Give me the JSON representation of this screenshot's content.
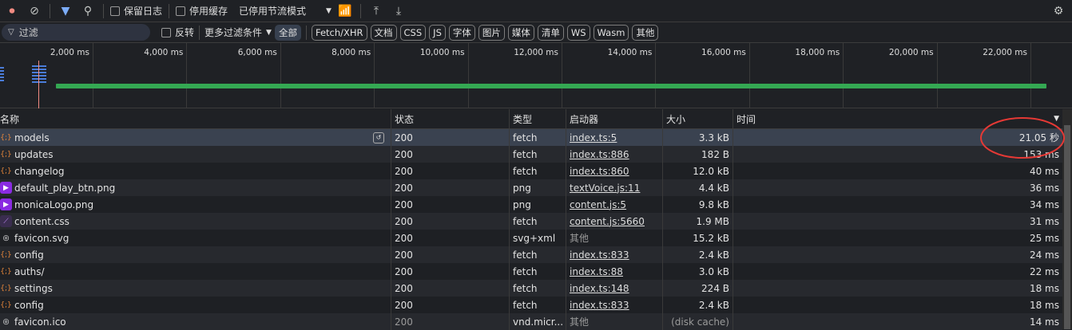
{
  "toolbar": {
    "preserve_log": "保留日志",
    "disable_cache": "停用缓存",
    "throttle": "已停用节流模式"
  },
  "filter": {
    "placeholder": "过滤",
    "invert": "反转",
    "more_filters": "更多过滤条件",
    "chips": [
      "全部",
      "Fetch/XHR",
      "文档",
      "CSS",
      "JS",
      "字体",
      "图片",
      "媒体",
      "清单",
      "WS",
      "Wasm",
      "其他"
    ]
  },
  "overview": {
    "ticks": [
      "2,000 ms",
      "4,000 ms",
      "6,000 ms",
      "8,000 ms",
      "10,000 ms",
      "12,000 ms",
      "14,000 ms",
      "16,000 ms",
      "18,000 ms",
      "20,000 ms",
      "22,000 ms"
    ]
  },
  "table": {
    "headers": [
      "名称",
      "状态",
      "类型",
      "启动器",
      "大小",
      "时间"
    ],
    "rows": [
      {
        "icon": "fetch",
        "name": "models",
        "status": "200",
        "type": "fetch",
        "initiator": "index.ts:5",
        "size": "3.3 kB",
        "time": "21.05 秒"
      },
      {
        "icon": "fetch",
        "name": "updates",
        "status": "200",
        "type": "fetch",
        "initiator": "index.ts:886",
        "size": "182 B",
        "time": "153 ms"
      },
      {
        "icon": "fetch",
        "name": "changelog",
        "status": "200",
        "type": "fetch",
        "initiator": "index.ts:860",
        "size": "12.0 kB",
        "time": "40 ms"
      },
      {
        "icon": "image",
        "name": "default_play_btn.png",
        "status": "200",
        "type": "png",
        "initiator": "textVoice.js:11",
        "size": "4.4 kB",
        "time": "36 ms"
      },
      {
        "icon": "image",
        "name": "monicaLogo.png",
        "status": "200",
        "type": "png",
        "initiator": "content.js:5",
        "size": "9.8 kB",
        "time": "34 ms"
      },
      {
        "icon": "css",
        "name": "content.css",
        "status": "200",
        "type": "fetch",
        "initiator": "content.js:5660",
        "size": "1.9 MB",
        "time": "31 ms"
      },
      {
        "icon": "other",
        "name": "favicon.svg",
        "status": "200",
        "type": "svg+xml",
        "initiator": "其他",
        "size": "15.2 kB",
        "time": "25 ms"
      },
      {
        "icon": "fetch",
        "name": "config",
        "status": "200",
        "type": "fetch",
        "initiator": "index.ts:833",
        "size": "2.4 kB",
        "time": "24 ms"
      },
      {
        "icon": "fetch",
        "name": "auths/",
        "status": "200",
        "type": "fetch",
        "initiator": "index.ts:88",
        "size": "3.0 kB",
        "time": "22 ms"
      },
      {
        "icon": "fetch",
        "name": "settings",
        "status": "200",
        "type": "fetch",
        "initiator": "index.ts:148",
        "size": "224 B",
        "time": "18 ms"
      },
      {
        "icon": "fetch",
        "name": "config",
        "status": "200",
        "type": "fetch",
        "initiator": "index.ts:833",
        "size": "2.4 kB",
        "time": "18 ms"
      },
      {
        "icon": "other",
        "name": "favicon.ico",
        "status": "200",
        "type": "vnd.micr...",
        "initiator": "其他",
        "size": "(disk cache)",
        "time": "14 ms"
      }
    ]
  },
  "colors": {
    "accent": "#7cacf8",
    "waterfall": "#34a853",
    "annotation": "#e53935"
  }
}
